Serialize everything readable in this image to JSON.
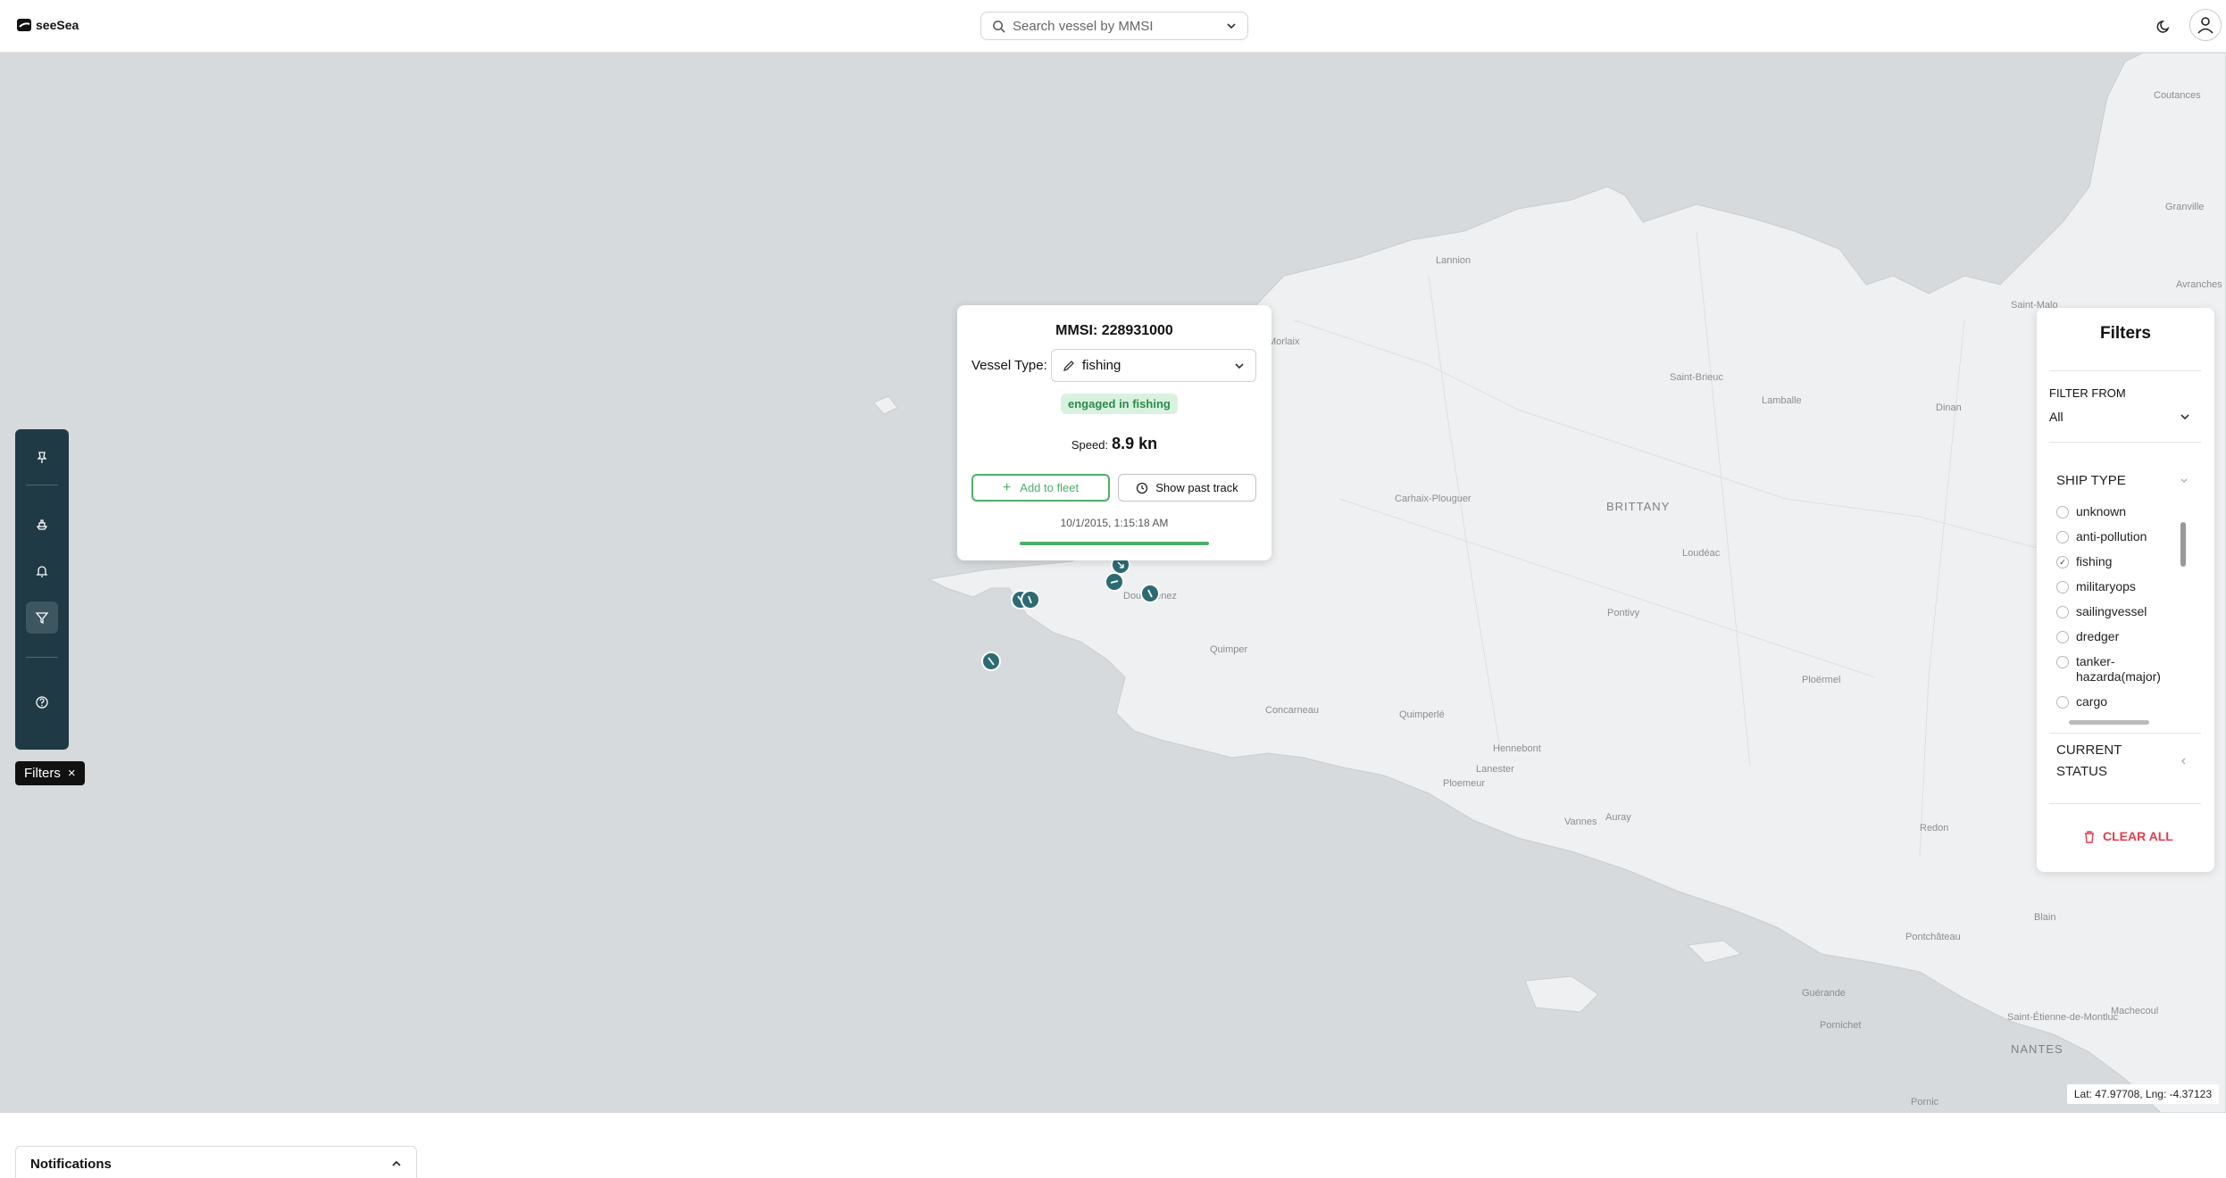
{
  "header": {
    "logo_text": "seeSea",
    "search_placeholder": "Search vessel by MMSI"
  },
  "map": {
    "places": [
      "Coutances",
      "Granville",
      "Avranches",
      "Saint-Malo",
      "Dinan",
      "Lamballe",
      "Saint-Brieuc",
      "Lannion",
      "Morlaix",
      "Carhaix-Plouguer",
      "Loudéac",
      "Pontivy",
      "Ploërmel",
      "Quimper",
      "Douarnenez",
      "Concarneau",
      "Quimperlé",
      "Hennebont",
      "Lanester",
      "Ploemeur",
      "Auray",
      "Vannes",
      "Redon",
      "Blain",
      "Pontchâteau",
      "Guérande",
      "Pornichet",
      "Saint-Étienne-de-Montluc",
      "Pornic",
      "Machecoul"
    ],
    "region_brittany": "BRITTANY",
    "region_nantes": "NANTES",
    "coordinates": "Lat: 47.97708, Lng: -4.37123"
  },
  "popup": {
    "title": "MMSI: 228931000",
    "vessel_type_label": "Vessel Type:",
    "vessel_type_value": "fishing",
    "status": "engaged in fishing",
    "speed_label": "Speed:",
    "speed_value": "8.9 kn",
    "add_to_fleet": "Add to fleet",
    "show_past_track": "Show past track",
    "timestamp": "10/1/2015, 1:15:18 AM",
    "progress": 1.0
  },
  "toolbar": {
    "chip_label": "Filters",
    "chip_close": "×"
  },
  "filters": {
    "title": "Filters",
    "filter_from_label": "FILTER FROM",
    "filter_from_value": "All",
    "ship_type_label": "SHIP TYPE",
    "ship_types": [
      {
        "label": "unknown",
        "checked": false
      },
      {
        "label": "anti-pollution",
        "checked": false
      },
      {
        "label": "fishing",
        "checked": true
      },
      {
        "label": "militaryops",
        "checked": false
      },
      {
        "label": "sailingvessel",
        "checked": false
      },
      {
        "label": "dredger",
        "checked": false
      },
      {
        "label": "tanker-hazarda(major)",
        "checked": false
      },
      {
        "label": "cargo",
        "checked": false
      }
    ],
    "current_status_label": "CURRENT STATUS",
    "clear_all": "CLEAR ALL"
  },
  "notifications": {
    "title": "Notifications"
  },
  "colors": {
    "toolbar_bg": "#1f3a44",
    "accent_green": "#4caf6a",
    "vessel": "#2d6b73",
    "danger": "#e23d4b"
  }
}
